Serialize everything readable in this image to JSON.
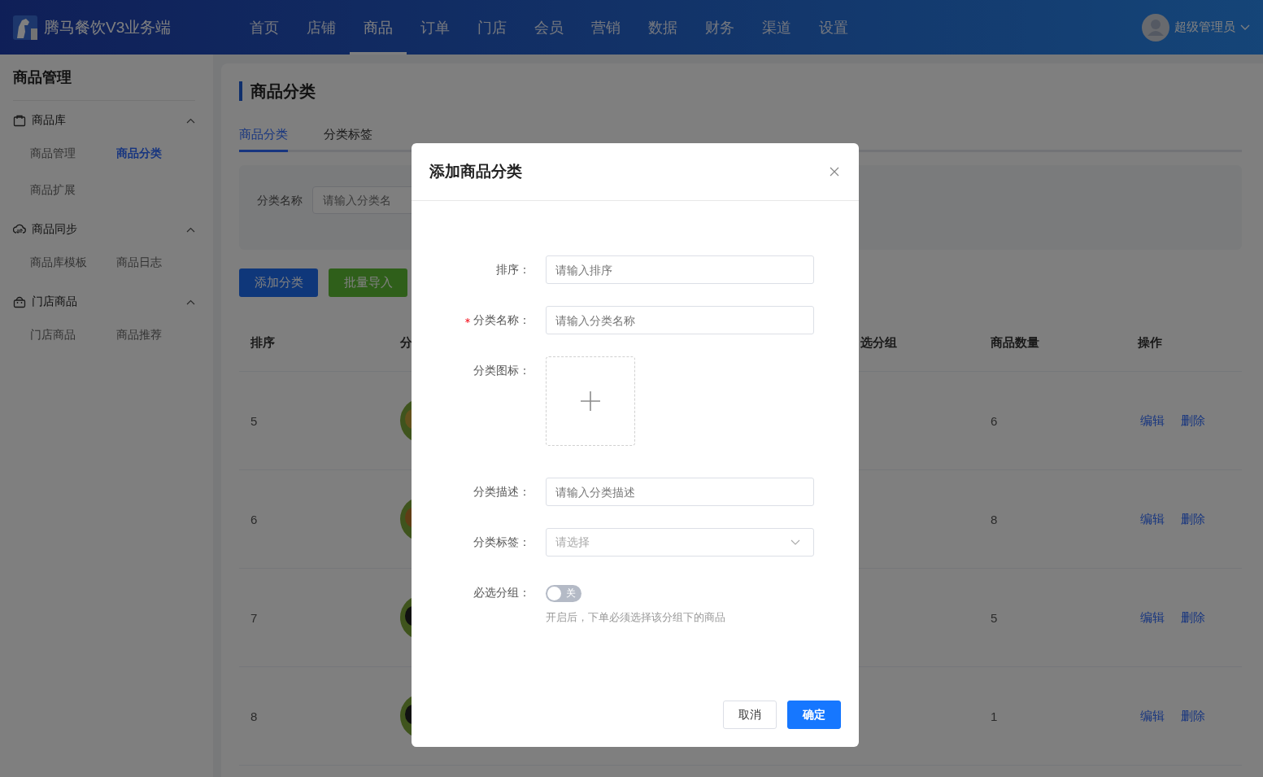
{
  "header": {
    "app_name": "腾马餐饮V3业务端",
    "nav": [
      {
        "label": "首页",
        "selected": false
      },
      {
        "label": "店铺",
        "selected": false
      },
      {
        "label": "商品",
        "selected": true
      },
      {
        "label": "订单",
        "selected": false
      },
      {
        "label": "门店",
        "selected": false
      },
      {
        "label": "会员",
        "selected": false
      },
      {
        "label": "营销",
        "selected": false
      },
      {
        "label": "数据",
        "selected": false
      },
      {
        "label": "财务",
        "selected": false
      },
      {
        "label": "渠道",
        "selected": false
      },
      {
        "label": "设置",
        "selected": false
      }
    ],
    "user": {
      "name": "超级管理员"
    }
  },
  "sidebar": {
    "title": "商品管理",
    "groups": [
      {
        "label": "商品库",
        "expanded": true,
        "items": [
          {
            "label": "商品管理",
            "selected": false
          },
          {
            "label": "商品分类",
            "selected": true
          },
          {
            "label": "商品扩展",
            "selected": false
          }
        ]
      },
      {
        "label": "商品同步",
        "expanded": true,
        "items": [
          {
            "label": "商品库模板",
            "selected": false
          },
          {
            "label": "商品日志",
            "selected": false
          }
        ]
      },
      {
        "label": "门店商品",
        "expanded": true,
        "items": [
          {
            "label": "门店商品",
            "selected": false
          },
          {
            "label": "商品推荐",
            "selected": false
          }
        ]
      }
    ]
  },
  "page": {
    "title": "商品分类",
    "tabs": [
      {
        "label": "商品分类",
        "selected": true
      },
      {
        "label": "分类标签",
        "selected": false
      }
    ],
    "filter": {
      "label": "分类名称",
      "placeholder": "请输入分类名"
    },
    "buttons": [
      {
        "label": "添加分类",
        "kind": "primary"
      },
      {
        "label": "批量导入",
        "kind": "success"
      }
    ],
    "table": {
      "columns": [
        "排序",
        "分",
        "选分组",
        "商品数量",
        "操作"
      ],
      "rows": [
        {
          "sort": "5",
          "count": "6",
          "actions": [
            "编辑",
            "删除"
          ]
        },
        {
          "sort": "6",
          "count": "8",
          "actions": [
            "编辑",
            "删除"
          ]
        },
        {
          "sort": "7",
          "count": "5",
          "actions": [
            "编辑",
            "删除"
          ]
        },
        {
          "sort": "8",
          "count": "1",
          "actions": [
            "编辑",
            "删除"
          ]
        }
      ]
    }
  },
  "dialog": {
    "title": "添加商品分类",
    "fields": [
      {
        "kind": "input",
        "label": "排序：",
        "required": false,
        "placeholder": "请输入排序"
      },
      {
        "kind": "input",
        "label": "分类名称：",
        "required": true,
        "placeholder": "请输入分类名称"
      },
      {
        "kind": "upload",
        "label": "分类图标：",
        "required": false
      },
      {
        "kind": "input",
        "label": "分类描述：",
        "required": false,
        "placeholder": "请输入分类描述"
      },
      {
        "kind": "select",
        "label": "分类标签：",
        "required": false,
        "placeholder": "请选择"
      },
      {
        "kind": "switch",
        "label": "必选分组：",
        "required": false,
        "on": false,
        "text": "关",
        "hint": "开启后，下单必须选择该分组下的商品"
      }
    ],
    "buttons": [
      {
        "label": "取消",
        "kind": "default"
      },
      {
        "label": "确定",
        "kind": "primary"
      }
    ]
  }
}
